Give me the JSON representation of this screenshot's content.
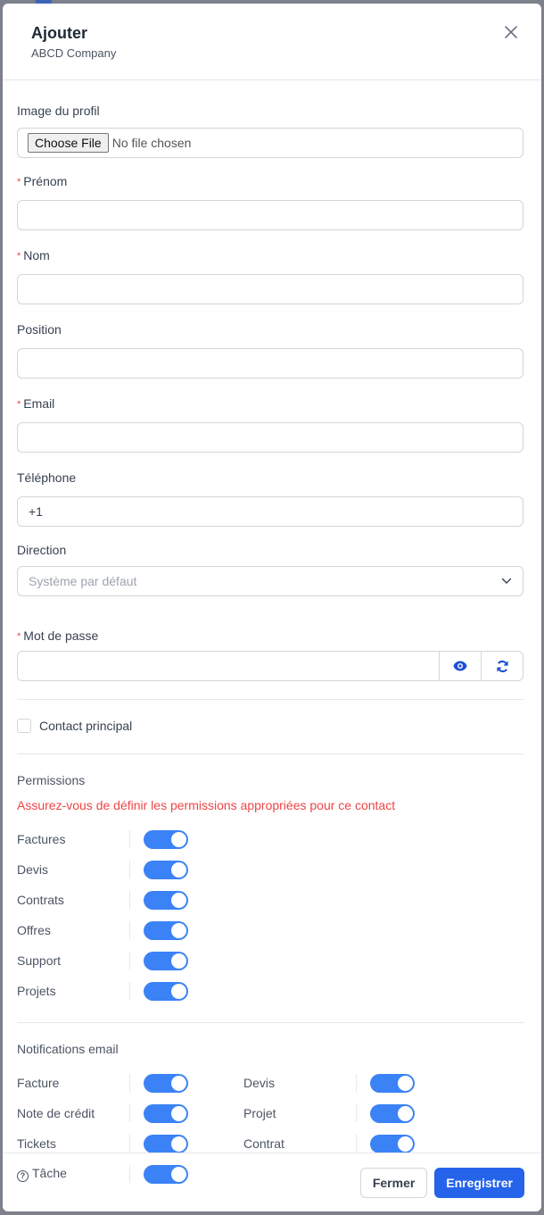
{
  "modal": {
    "title": "Ajouter",
    "subtitle": "ABCD Company"
  },
  "form": {
    "profile_image": {
      "label": "Image du profil",
      "button": "Choose File",
      "status": "No file chosen"
    },
    "first_name": {
      "label": "Prénom",
      "required": "*",
      "value": ""
    },
    "last_name": {
      "label": "Nom",
      "required": "*",
      "value": ""
    },
    "position": {
      "label": "Position",
      "value": ""
    },
    "email": {
      "label": "Email",
      "required": "*",
      "value": ""
    },
    "phone": {
      "label": "Téléphone",
      "value": "+1"
    },
    "direction": {
      "label": "Direction",
      "selected": "Système par défaut"
    },
    "password": {
      "label": "Mot de passe",
      "required": "*",
      "value": ""
    },
    "primary_contact": {
      "label": "Contact principal",
      "checked": false
    }
  },
  "permissions": {
    "title": "Permissions",
    "warning": "Assurez-vous de définir les permissions appropriées pour ce contact",
    "items": [
      {
        "label": "Factures",
        "enabled": true
      },
      {
        "label": "Devis",
        "enabled": true
      },
      {
        "label": "Contrats",
        "enabled": true
      },
      {
        "label": "Offres",
        "enabled": true
      },
      {
        "label": "Support",
        "enabled": true
      },
      {
        "label": "Projets",
        "enabled": true
      }
    ]
  },
  "notifications": {
    "title": "Notifications email",
    "items": [
      {
        "label": "Facture",
        "enabled": true
      },
      {
        "label": "Devis",
        "enabled": true
      },
      {
        "label": "Note de crédit",
        "enabled": true
      },
      {
        "label": "Projet",
        "enabled": true
      },
      {
        "label": "Tickets",
        "enabled": true
      },
      {
        "label": "Contrat",
        "enabled": true
      },
      {
        "label": "Tâche",
        "enabled": true,
        "help_icon": "?"
      }
    ]
  },
  "footer": {
    "close_label": "Fermer",
    "save_label": "Enregistrer"
  },
  "colors": {
    "accent": "#3b82f6",
    "primary_button": "#2563eb",
    "warning": "#ef4444"
  }
}
